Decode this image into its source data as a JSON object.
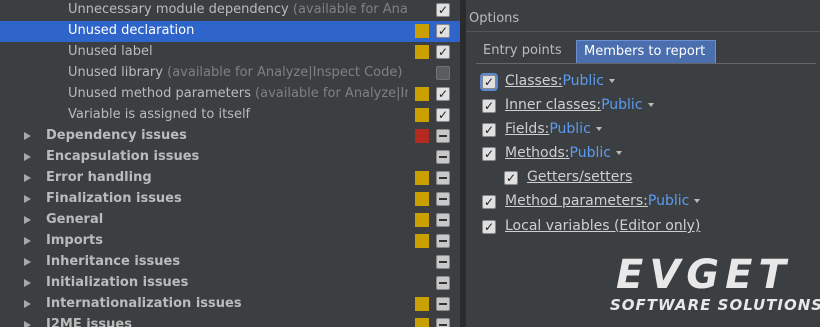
{
  "inspections": {
    "children": [
      {
        "label": "Unnecessary module dependency",
        "hint": "(available for Analyze|Inspect Code)",
        "severity": "none",
        "check": "checked"
      },
      {
        "label": "Unused declaration",
        "hint": "",
        "severity": "#c9a000",
        "check": "checked"
      },
      {
        "label": "Unused label",
        "hint": "",
        "severity": "#c9a000",
        "check": "checked"
      },
      {
        "label": "Unused library",
        "hint": "(available for Analyze|Inspect Code)",
        "severity": "none",
        "check": "unchecked"
      },
      {
        "label": "Unused method parameters",
        "hint": "(available for Analyze|Inspect Code)",
        "severity": "#c9a000",
        "check": "checked"
      },
      {
        "label": "Variable is assigned to itself",
        "hint": "",
        "severity": "#c9a000",
        "check": "checked"
      }
    ],
    "groups": [
      {
        "label": "Dependency issues",
        "severity": "#b52a1f",
        "check": "partial"
      },
      {
        "label": "Encapsulation issues",
        "severity": "none",
        "check": "partial"
      },
      {
        "label": "Error handling",
        "severity": "#c9a000",
        "check": "partial"
      },
      {
        "label": "Finalization issues",
        "severity": "#c9a000",
        "check": "partial"
      },
      {
        "label": "General",
        "severity": "#c9a000",
        "check": "partial"
      },
      {
        "label": "Imports",
        "severity": "#c9a000",
        "check": "partial"
      },
      {
        "label": "Inheritance issues",
        "severity": "none",
        "check": "partial"
      },
      {
        "label": "Initialization issues",
        "severity": "none",
        "check": "partial"
      },
      {
        "label": "Internationalization issues",
        "severity": "#c9a000",
        "check": "partial"
      },
      {
        "label": "J2ME issues",
        "severity": "#c9a000",
        "check": "partial"
      }
    ]
  },
  "options": {
    "title": "Options",
    "tabs": [
      {
        "label": "Entry points",
        "active": false
      },
      {
        "label": "Members to report",
        "active": true
      }
    ],
    "items": [
      {
        "label": "Classes:",
        "value": "Public",
        "dropdown": true
      },
      {
        "label": "Inner classes:",
        "value": "Public",
        "dropdown": true
      },
      {
        "label": "Fields:",
        "value": "Public",
        "dropdown": true
      },
      {
        "label": "Methods:",
        "value": "Public",
        "dropdown": true
      },
      {
        "label": "Getters/setters",
        "value": "",
        "dropdown": false
      },
      {
        "label": "Method parameters:",
        "value": "Public",
        "dropdown": true
      },
      {
        "label": "Local variables (Editor only)",
        "value": "",
        "dropdown": false
      }
    ]
  },
  "watermark": {
    "brand": "EVGET",
    "tagline": "SOFTWARE SOLUTIONS"
  },
  "colors": {
    "selection": "#2f65ca",
    "warning": "#c9a000",
    "error": "#b52a1f",
    "link": "#5c9bf0"
  }
}
